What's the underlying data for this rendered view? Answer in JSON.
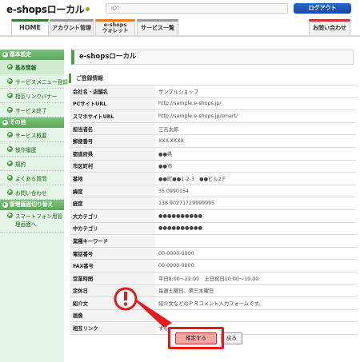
{
  "header": {
    "logo_text": "e-shopsローカル",
    "id_label": "ID：",
    "logout_label": "ログアウト"
  },
  "tabs": [
    {
      "label": "HOME"
    },
    {
      "label": "アカウント管理"
    },
    {
      "label": "e-shops",
      "label2": "ウォレット"
    },
    {
      "label": "サービス一覧"
    },
    {
      "label": "お問い合わせ"
    }
  ],
  "sidebar": {
    "groups": [
      {
        "title": "基本設定",
        "items": [
          "基本情報",
          "サービスメニュー登録",
          "相互リンクバナー",
          "サービス終了"
        ]
      },
      {
        "title": "その他",
        "items": [
          "サービス概要",
          "操作履歴",
          "規約",
          "よくある質問",
          "お問い合わせ"
        ]
      },
      {
        "title": "管理画面切り替え",
        "items": [
          "スマートフォン用管理画面へ"
        ]
      }
    ]
  },
  "main": {
    "page_title": "e-shopsローカル",
    "section_title": "ご登録情報",
    "rows": [
      {
        "key": "会社名・店舗名",
        "value": "サンプルショップ"
      },
      {
        "key": "PCサイトURL",
        "value": "http://sample.e-shops.jp/"
      },
      {
        "key": "スマホサイトURL",
        "value": "http://sample.e-shops.jp/smart/"
      },
      {
        "key": "担当者名",
        "value": "三吉太郎"
      },
      {
        "key": "郵便番号",
        "value": "XXX-XXXX"
      },
      {
        "key": "都道府県",
        "value": "●●県"
      },
      {
        "key": "市区町村",
        "value": "●●市"
      },
      {
        "key": "番地",
        "value": "●●町●●1-2-3　●●ビル2Ｆ"
      },
      {
        "key": "緯度",
        "value": "35.0990154"
      },
      {
        "key": "経度",
        "value": "138.90271729999995"
      },
      {
        "key": "大カテゴリ",
        "value": "●●●●●●●●●●"
      },
      {
        "key": "中カテゴリ",
        "value": "●●●●●●●●●●"
      },
      {
        "key": "業種キーワード",
        "value": ""
      },
      {
        "key": "電話番号",
        "value": "00-0000-0000"
      },
      {
        "key": "FAX番号",
        "value": "00-0000-0000"
      },
      {
        "key": "営業時間",
        "value": "平日8:00〜22:00　土日祝日10:00〜19:00"
      },
      {
        "key": "定休日",
        "value": "毎週土曜日、第三木曜日"
      },
      {
        "key": "紹介文",
        "value": "紹介文などのＰＲコメント入力フォームです。"
      },
      {
        "key": "画像",
        "value": ""
      },
      {
        "key": "相互リンク",
        "value": "する"
      }
    ],
    "confirm_label": "確定する",
    "back_label": "戻る"
  },
  "colors": {
    "accent_green": "#4a9f4a",
    "logout_blue": "#1748a8",
    "callout_red": "#e21b1b",
    "confirm_pink": "#f2a6a6"
  },
  "icons": {
    "warning": "exclamation-circle-icon",
    "nav_arrow": "arrow-right-circle-icon"
  }
}
